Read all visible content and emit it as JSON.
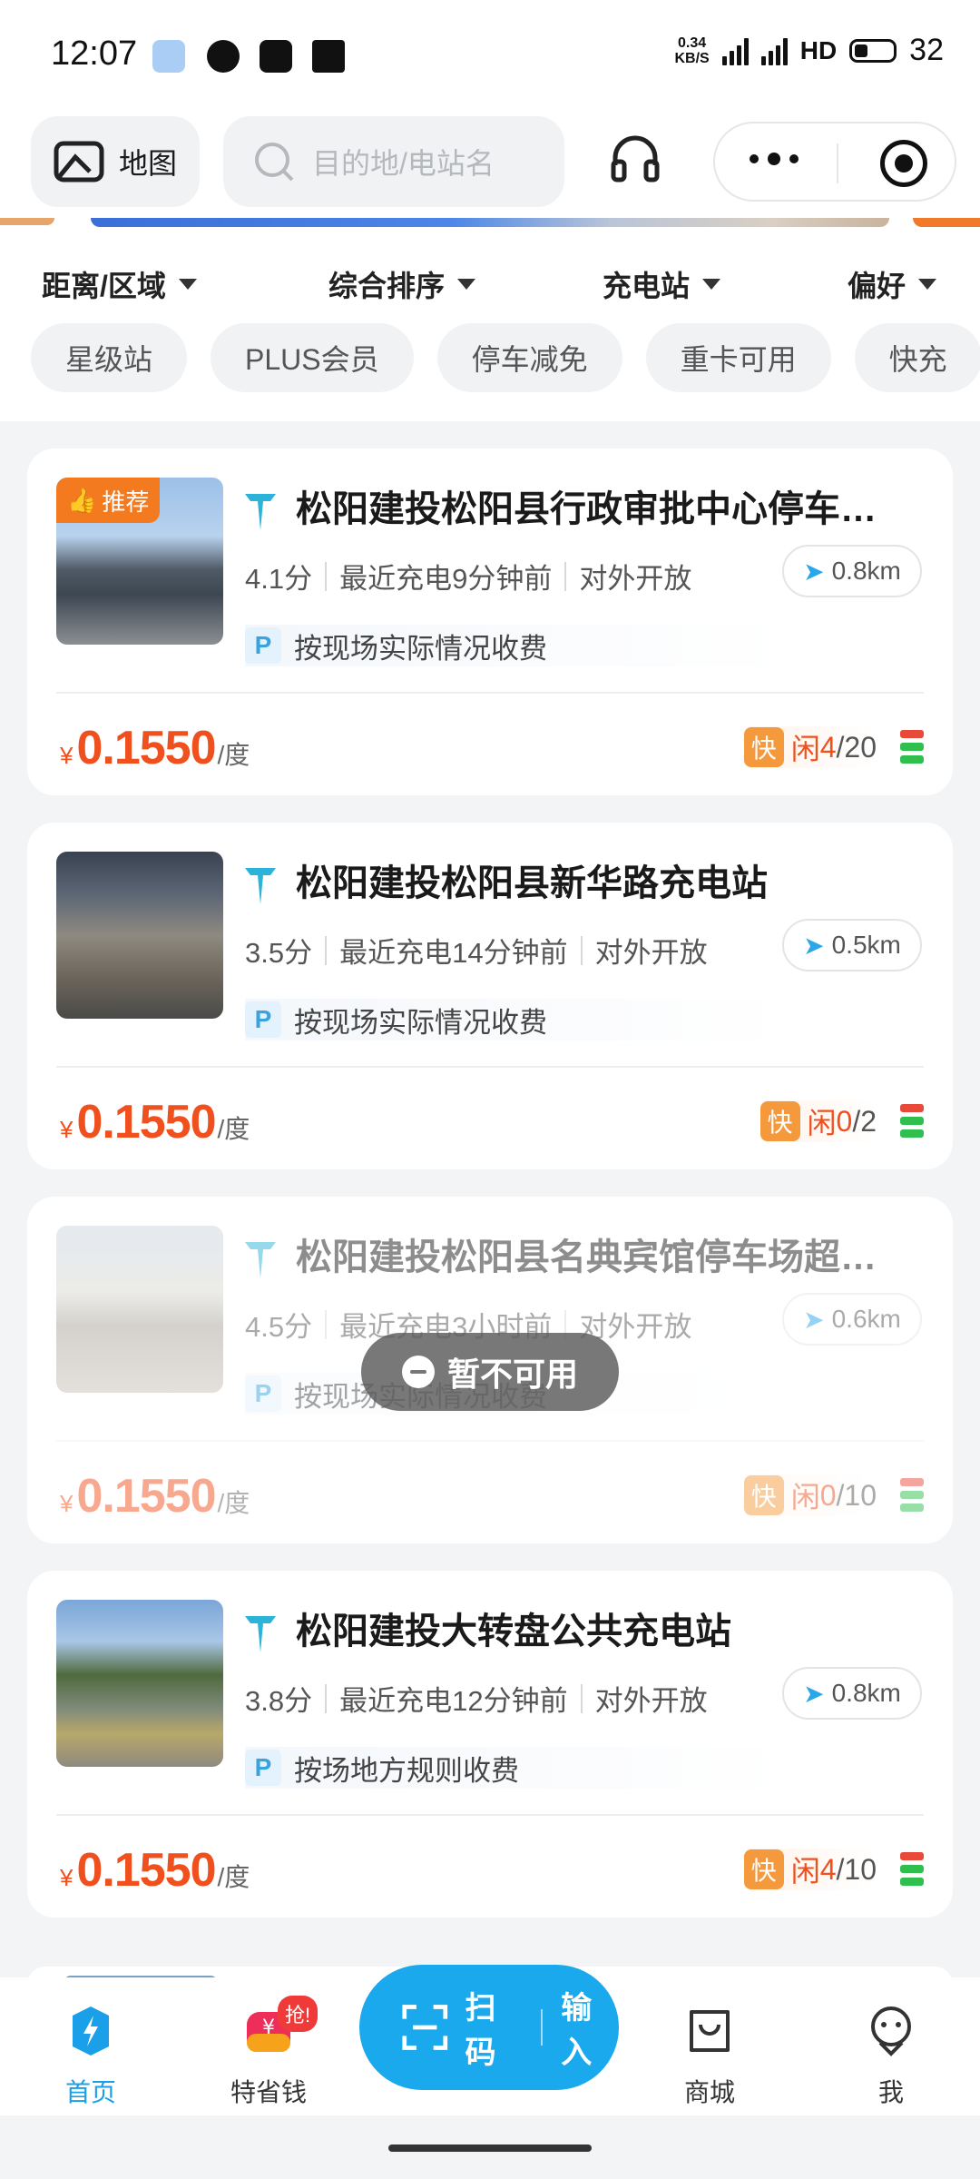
{
  "status_bar": {
    "time": "12:07",
    "net_speed_top": "0.34",
    "net_speed_bottom": "KB/S",
    "sim1": "5G",
    "sim2": "5G",
    "hd": "HD",
    "battery": "32"
  },
  "header": {
    "map_label": "地图",
    "search_placeholder": "目的地/电站名"
  },
  "filters": {
    "dropdowns": [
      "距离/区域",
      "综合排序",
      "充电站",
      "偏好"
    ],
    "tags": [
      "星级站",
      "PLUS会员",
      "停车减免",
      "重卡可用",
      "快充"
    ]
  },
  "stations": [
    {
      "title": "松阳建投松阳县行政审批中心停车…",
      "badge": "推荐",
      "rating": "4.1分",
      "last_charge": "最近充电9分钟前",
      "open": "对外开放",
      "distance": "0.8km",
      "fee": "按现场实际情况收费",
      "currency": "¥",
      "price": "0.1550",
      "unit": "/度",
      "fast": "快",
      "idle_label": "闲",
      "idle": "4",
      "total": "/20"
    },
    {
      "title": "松阳建投松阳县新华路充电站",
      "rating": "3.5分",
      "last_charge": "最近充电14分钟前",
      "open": "对外开放",
      "distance": "0.5km",
      "fee": "按现场实际情况收费",
      "currency": "¥",
      "price": "0.1550",
      "unit": "/度",
      "fast": "快",
      "idle_label": "闲",
      "idle": "0",
      "total": "/2"
    },
    {
      "title": "松阳建投松阳县名典宾馆停车场超…",
      "rating": "4.5分",
      "last_charge": "最近充电3小时前",
      "open": "对外开放",
      "distance": "0.6km",
      "fee": "按现场实际情况收费",
      "currency": "¥",
      "price": "0.1550",
      "unit": "/度",
      "fast": "快",
      "idle_label": "闲",
      "idle": "0",
      "total": "/10",
      "unavailable": "暂不可用"
    },
    {
      "title": "松阳建投大转盘公共充电站",
      "rating": "3.8分",
      "last_charge": "最近充电12分钟前",
      "open": "对外开放",
      "distance": "0.8km",
      "fee": "按场地方规则收费",
      "currency": "¥",
      "price": "0.1550",
      "unit": "/度",
      "fast": "快",
      "idle_label": "闲",
      "idle": "4",
      "total": "/10"
    }
  ],
  "tabbar": {
    "home": "首页",
    "save": "特省钱",
    "save_badge": "抢!",
    "scan": "扫码",
    "input": "输入",
    "mall": "商城",
    "me": "我"
  },
  "colors": {
    "accent": "#1aa9ec",
    "price": "#f0501e",
    "badge": "#f37a1f"
  }
}
